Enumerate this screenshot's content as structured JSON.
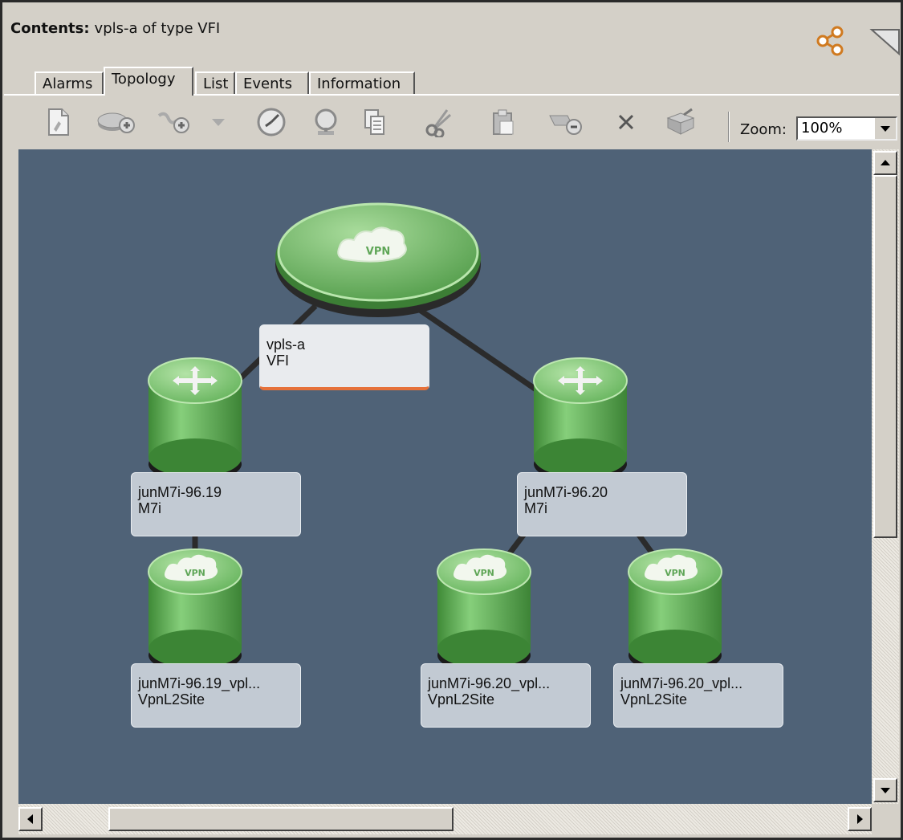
{
  "header": {
    "label": "Contents:",
    "text": "vpls-a of type VFI"
  },
  "tabs": [
    {
      "label": "Alarms"
    },
    {
      "label": "Topology"
    },
    {
      "label": "List"
    },
    {
      "label": "Events"
    },
    {
      "label": "Information"
    }
  ],
  "active_tab": "Topology",
  "toolbar": {
    "zoom_label": "Zoom:",
    "zoom_value": "100%",
    "buttons": [
      "new-page-icon",
      "add-device-icon",
      "add-service-icon",
      "dropdown-arrow-icon",
      "clock-icon",
      "magnifier-icon",
      "copy-icon",
      "cut-icon",
      "paste-icon",
      "remove-from-group-icon",
      "delete-icon",
      "export-icon"
    ]
  },
  "colors": {
    "canvas_bg": "#4f6277",
    "node_green": "#74c16b",
    "selection_bar": "#e6713a"
  },
  "topology": {
    "nodes": [
      {
        "id": "vpls-a",
        "line1": "vpls-a",
        "line2": "VFI",
        "icon": "vpn-cloud-icon",
        "shape": "ellipse",
        "selected": true
      },
      {
        "id": "m719",
        "line1": "junM7i-96.19",
        "line2": "M7i",
        "icon": "router-arrows-icon",
        "shape": "cylinder"
      },
      {
        "id": "m720",
        "line1": "junM7i-96.20",
        "line2": "M7i",
        "icon": "router-arrows-icon",
        "shape": "cylinder"
      },
      {
        "id": "s1",
        "line1": "junM7i-96.19_vpl...",
        "line2": "VpnL2Site",
        "icon": "vpn-cloud-icon",
        "shape": "cylinder"
      },
      {
        "id": "s2",
        "line1": "junM7i-96.20_vpl...",
        "line2": "VpnL2Site",
        "icon": "vpn-cloud-icon",
        "shape": "cylinder"
      },
      {
        "id": "s3",
        "line1": "junM7i-96.20_vpl...",
        "line2": "VpnL2Site",
        "icon": "vpn-cloud-icon",
        "shape": "cylinder"
      }
    ],
    "links": [
      [
        "vpls-a",
        "m719"
      ],
      [
        "vpls-a",
        "m720"
      ],
      [
        "m719",
        "s1"
      ],
      [
        "m720",
        "s2"
      ],
      [
        "m720",
        "s3"
      ]
    ]
  },
  "scroll": {
    "vertical_position": 0.0,
    "horizontal_position": 0.0
  }
}
